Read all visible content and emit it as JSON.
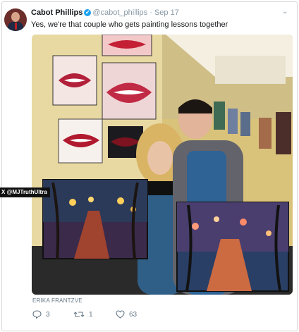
{
  "tweet": {
    "author_name": "Cabot Phillips",
    "handle": "@cabot_phillips",
    "date": "Sep 17",
    "separator": "·",
    "text": "Yes, we're that couple who gets painting lessons together",
    "image_credit": "ERIKA FRANTZVE",
    "watermark": "@MJTruthUltra",
    "watermark_logo": "X",
    "verified_glyph": "✔",
    "menu_glyph": "⌄",
    "counts": {
      "replies": "3",
      "retweets": "1",
      "likes": "63"
    }
  },
  "colors": {
    "verified": "#1da1f2",
    "meta": "#8899a6",
    "action": "#657786"
  },
  "icons": [
    "avatar",
    "verified-badge-icon",
    "chevron-down-icon",
    "reply-icon",
    "retweet-icon",
    "like-icon"
  ]
}
